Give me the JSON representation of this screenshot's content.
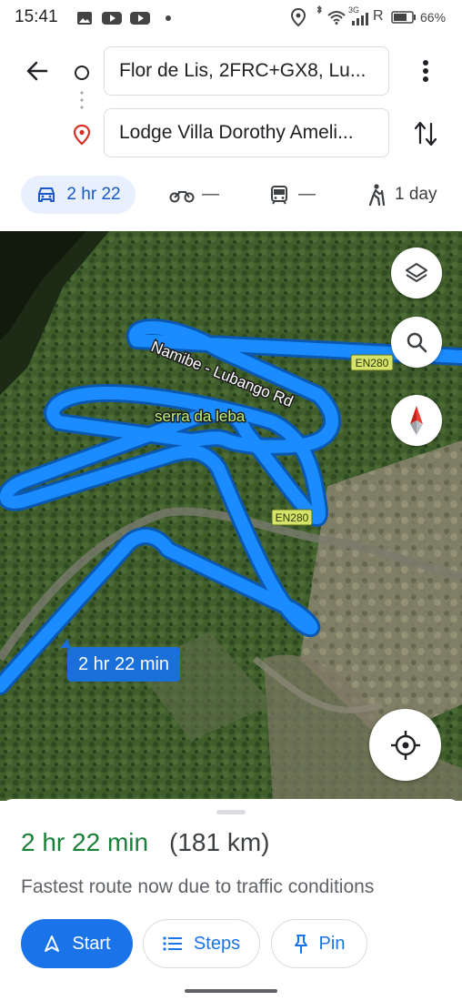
{
  "status_bar": {
    "time": "15:41",
    "network": "3G",
    "carrier_letter": "R",
    "battery": "66%"
  },
  "route": {
    "origin": "Flor de Lis, 2FRC+GX8, Lu...",
    "destination": "Lodge Villa Dorothy Ameli..."
  },
  "modes": {
    "drive": "2 hr 22",
    "motorcycle": "—",
    "transit": "—",
    "walk": "1 day"
  },
  "map": {
    "road_label": "Namibe - Lubango Rd",
    "place_label": "serra da leba",
    "shield_1": "EN280",
    "shield_2": "EN280",
    "route_callout": "2 hr 22 min"
  },
  "sheet": {
    "duration": "2 hr 22 min",
    "distance": "(181 km)",
    "subtitle": "Fastest route now due to traffic conditions",
    "start_label": "Start",
    "steps_label": "Steps",
    "pin_label": "Pin"
  },
  "colors": {
    "route_blue": "#1a8cff",
    "accent_blue": "#1a73e8",
    "green": "#188038"
  }
}
